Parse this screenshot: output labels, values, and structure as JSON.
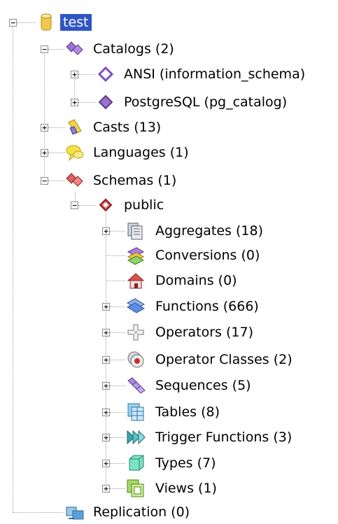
{
  "tree": {
    "root": {
      "label": "test",
      "icon": "database-icon",
      "selected": true
    },
    "catalogs": {
      "label": "Catalogs (2)",
      "icon": "catalogs-icon",
      "items": [
        {
          "label": "ANSI (information_schema)",
          "icon": "catalog-icon"
        },
        {
          "label": "PostgreSQL (pg_catalog)",
          "icon": "catalog-icon"
        }
      ]
    },
    "casts": {
      "label": "Casts (13)",
      "icon": "casts-icon"
    },
    "languages": {
      "label": "Languages (1)",
      "icon": "languages-icon"
    },
    "schemas": {
      "label": "Schemas (1)",
      "icon": "schemas-icon",
      "public": {
        "label": "public",
        "icon": "schema-icon",
        "items": [
          {
            "label": "Aggregates (18)",
            "icon": "aggregates-icon"
          },
          {
            "label": "Conversions (0)",
            "icon": "conversions-icon"
          },
          {
            "label": "Domains (0)",
            "icon": "domains-icon"
          },
          {
            "label": "Functions (666)",
            "icon": "functions-icon"
          },
          {
            "label": "Operators (17)",
            "icon": "operators-icon"
          },
          {
            "label": "Operator Classes (2)",
            "icon": "operator-classes-icon"
          },
          {
            "label": "Sequences (5)",
            "icon": "sequences-icon"
          },
          {
            "label": "Tables (8)",
            "icon": "tables-icon"
          },
          {
            "label": "Trigger Functions (3)",
            "icon": "trigger-functions-icon"
          },
          {
            "label": "Types (7)",
            "icon": "types-icon"
          },
          {
            "label": "Views (1)",
            "icon": "views-icon"
          }
        ]
      }
    },
    "replication": {
      "label": "Replication (0)",
      "icon": "replication-icon"
    }
  },
  "colors": {
    "selection": "#2f55c5"
  }
}
